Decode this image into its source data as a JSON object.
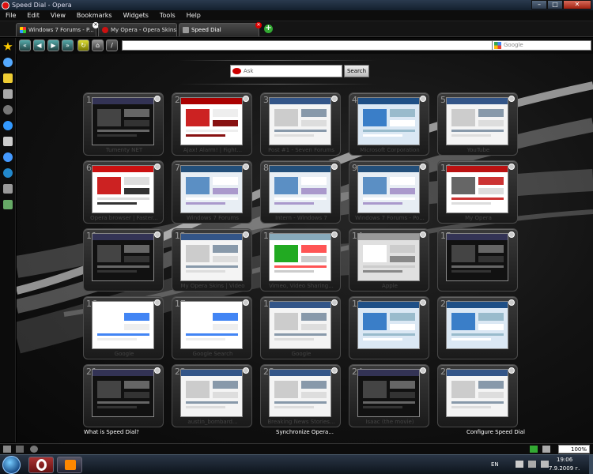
{
  "window": {
    "title": "Speed Dial - Opera",
    "minimize": "–",
    "maximize": "□",
    "close": "✕"
  },
  "menu": [
    "File",
    "Edit",
    "View",
    "Bookmarks",
    "Widgets",
    "Tools",
    "Help"
  ],
  "tabs": [
    {
      "label": "Windows 7 Forums - P...",
      "active": false
    },
    {
      "label": "My Opera - Opera Skins",
      "active": false
    },
    {
      "label": "Speed Dial",
      "active": true
    }
  ],
  "new_tab": "+",
  "nav": {
    "back": "◀",
    "forward": "▶",
    "rewind": "«",
    "fastforward": "»",
    "reload": "↻",
    "home": "⌂",
    "edit": "/"
  },
  "address": {
    "value": ""
  },
  "search": {
    "placeholder": "Google",
    "engine_icon": "google-icon"
  },
  "speed_dial": {
    "search_placeholder": "Ask",
    "search_button": "Search",
    "dials": [
      {
        "n": "1",
        "label": "Tumenty NET",
        "theme": "dark"
      },
      {
        "n": "2",
        "label": "Ajax! Alarm! | Fight...",
        "theme": "red"
      },
      {
        "n": "3",
        "label": "Post #1 - Seven Forums",
        "theme": "white"
      },
      {
        "n": "4",
        "label": "Microsoft Corporation",
        "theme": "blue"
      },
      {
        "n": "5",
        "label": "YouTube",
        "theme": "white"
      },
      {
        "n": "6",
        "label": "Opera browser | Faster...",
        "theme": "opera"
      },
      {
        "n": "7",
        "label": "Windows 7 Forums",
        "theme": "w7"
      },
      {
        "n": "8",
        "label": "Intern - Windows 7",
        "theme": "w7"
      },
      {
        "n": "9",
        "label": "Windows 7 Forums - Po...",
        "theme": "w7"
      },
      {
        "n": "10",
        "label": "My Opera",
        "theme": "myopera"
      },
      {
        "n": "11",
        "label": "",
        "theme": "dark"
      },
      {
        "n": "12",
        "label": "My Opera Skins | Video",
        "theme": "white"
      },
      {
        "n": "13",
        "label": "Vimeo, Video Sharing...",
        "theme": "vimeo"
      },
      {
        "n": "14",
        "label": "Apple",
        "theme": "apple"
      },
      {
        "n": "15",
        "label": "",
        "theme": "dark"
      },
      {
        "n": "16",
        "label": "Google",
        "theme": "google"
      },
      {
        "n": "17",
        "label": "Google Search",
        "theme": "google"
      },
      {
        "n": "18",
        "label": "Google",
        "theme": "white"
      },
      {
        "n": "19",
        "label": "",
        "theme": "blue"
      },
      {
        "n": "20",
        "label": "",
        "theme": "blue"
      },
      {
        "n": "21",
        "label": "",
        "theme": "dark"
      },
      {
        "n": "22",
        "label": "austin_bombard...",
        "theme": "white"
      },
      {
        "n": "23",
        "label": "Breaking News Stories...",
        "theme": "white"
      },
      {
        "n": "24",
        "label": "Isaac (the movie)",
        "theme": "dark"
      },
      {
        "n": "25",
        "label": "",
        "theme": "white"
      }
    ],
    "footer": {
      "left": "What is Speed Dial?",
      "center": "Synchronize Opera...",
      "right": "Configure Speed Dial"
    }
  },
  "status": {
    "zoom": "100%"
  },
  "taskbar": {
    "lang": "EN",
    "time": "19:06",
    "date": "7.9.2009 г."
  },
  "colors": {
    "accent": "#3a7ec8",
    "opera_red": "#cc1111",
    "bg": "#0a0a0a"
  }
}
